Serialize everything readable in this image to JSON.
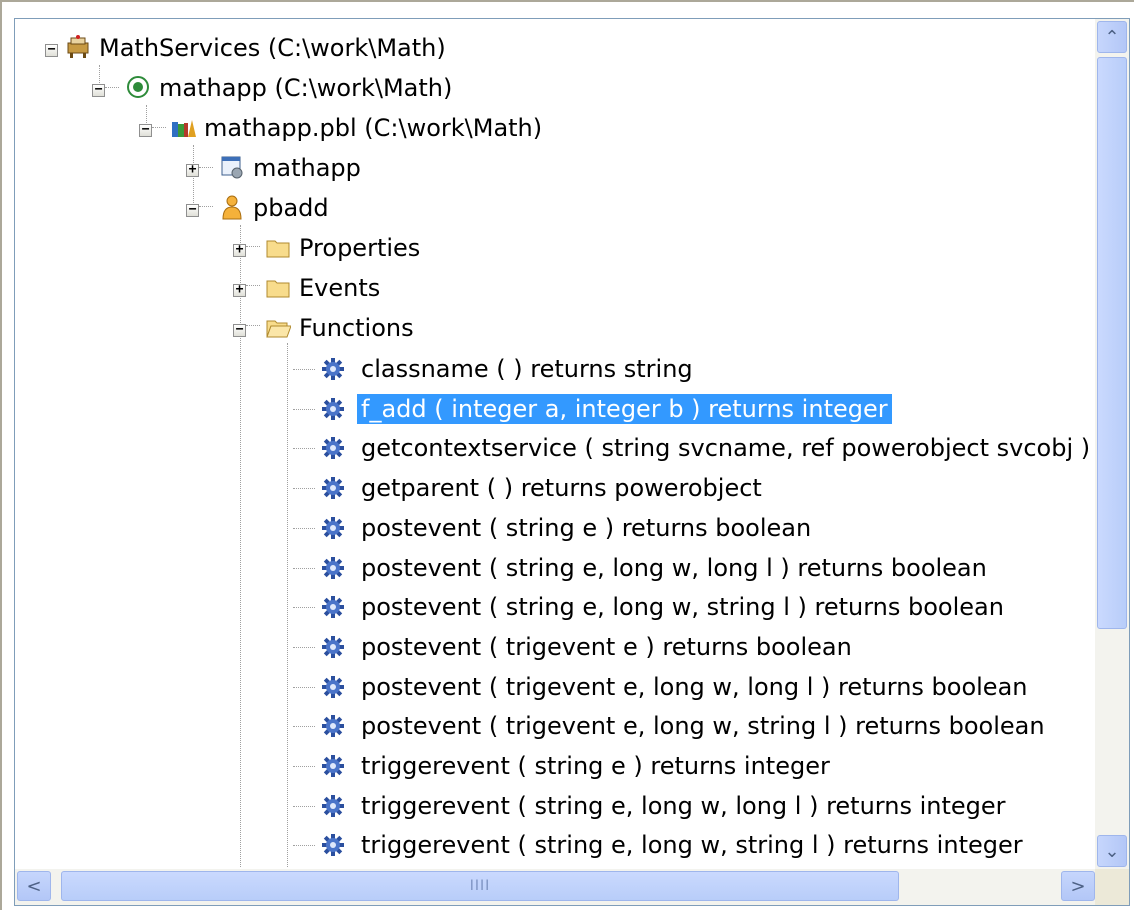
{
  "tree": {
    "nodes": [
      {
        "label": "MathServices (C:\\work\\Math)",
        "icon": "workspace-icon",
        "expander": "−"
      },
      {
        "label": "mathapp (C:\\work\\Math)",
        "icon": "target-icon",
        "expander": "−"
      },
      {
        "label": "mathapp.pbl (C:\\work\\Math)",
        "icon": "library-icon",
        "expander": "−"
      },
      {
        "label": "mathapp",
        "icon": "application-object-icon",
        "expander": "+"
      },
      {
        "label": "pbadd",
        "icon": "user-object-icon",
        "expander": "−"
      },
      {
        "label": "Properties",
        "icon": "folder-icon",
        "expander": "+"
      },
      {
        "label": "Events",
        "icon": "folder-icon",
        "expander": "+"
      },
      {
        "label": "Functions",
        "icon": "folder-open-icon",
        "expander": "−"
      }
    ],
    "functions": [
      {
        "label": "classname ( )  returns string"
      },
      {
        "label": "f_add ( integer a, integer b )  returns integer",
        "selected": true
      },
      {
        "label": "getcontextservice ( string svcname, ref powerobject svcobj )"
      },
      {
        "label": "getparent ( )  returns powerobject"
      },
      {
        "label": "postevent ( string e )  returns boolean"
      },
      {
        "label": "postevent ( string e, long w, long l )  returns boolean"
      },
      {
        "label": "postevent ( string e, long w, string l )  returns boolean"
      },
      {
        "label": "postevent ( trigevent e )  returns boolean"
      },
      {
        "label": "postevent ( trigevent e, long w, long l )  returns boolean"
      },
      {
        "label": "postevent ( trigevent e, long w, string l )  returns boolean"
      },
      {
        "label": "triggerevent ( string e )  returns integer"
      },
      {
        "label": "triggerevent ( string e, long w, long l )  returns integer"
      },
      {
        "label": "triggerevent ( string e, long w, string l )  returns integer"
      }
    ],
    "function_icon": "gear-icon",
    "selection_color": "#3399ff"
  },
  "scrollbars": {
    "up_arrow": "⌃",
    "down_arrow": "⌄",
    "left_arrow": "<",
    "right_arrow": ">",
    "grip": "IIII"
  }
}
